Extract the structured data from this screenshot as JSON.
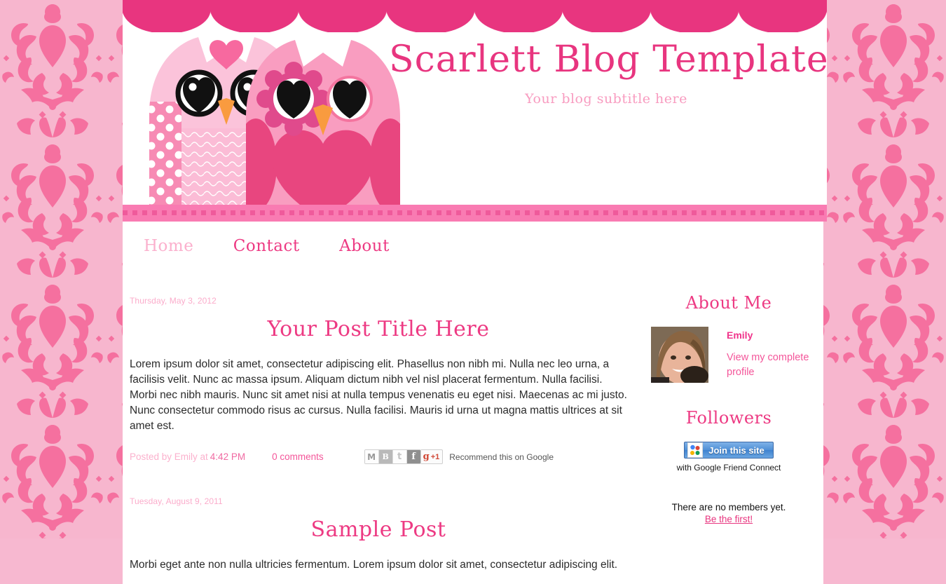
{
  "header": {
    "title": "Scarlett Blog Template",
    "subtitle": "Your blog subtitle here",
    "scallop_color": "#e8357f",
    "title_color": "#e8357f",
    "subtitle_color": "#f89cc0"
  },
  "nav": {
    "items": [
      {
        "label": "Home",
        "active": true
      },
      {
        "label": "Contact",
        "active": false
      },
      {
        "label": "About",
        "active": false
      }
    ]
  },
  "posts": [
    {
      "date": "Thursday, May 3, 2012",
      "title": "Your Post Title Here",
      "body": "Lorem ipsum dolor sit amet, consectetur adipiscing elit. Phasellus non nibh mi. Nulla nec leo urna, a facilisis velit. Nunc ac massa ipsum. Aliquam dictum nibh vel nisl placerat fermentum. Nulla facilisi. Morbi nec nibh mauris. Nunc sit amet nisi at nulla tempus venenatis eu eget nisi. Maecenas ac mi justo. Nunc consectetur commodo risus ac cursus. Nulla facilisi. Mauris id urna ut magna mattis ultrices at sit amet est.",
      "posted_by": "Posted by Emily at",
      "time": "4:42 PM",
      "comments": "0 comments",
      "share": {
        "icons": [
          "gmail-icon",
          "blogger-icon",
          "twitter-icon",
          "facebook-icon"
        ],
        "gmail_glyph": "M",
        "blogger_glyph": "B",
        "twitter_glyph": "t",
        "facebook_glyph": "f",
        "gplus_glyph": "g",
        "gplus_count": "+1",
        "recommend_text": "Recommend this on Google"
      }
    },
    {
      "date": "Tuesday, August 9, 2011",
      "title": "Sample Post",
      "body": "Morbi eget ante non nulla ultricies fermentum. Lorem ipsum dolor sit amet, consectetur adipiscing elit."
    }
  ],
  "sidebar": {
    "about": {
      "heading": "About Me",
      "name": "Emily",
      "profile_link": "View my complete profile"
    },
    "followers": {
      "heading": "Followers",
      "join_label": "Join this site",
      "gfc_sub": "with Google Friend Connect",
      "no_members": "There are no members yet.",
      "be_first": "Be the first!"
    }
  },
  "colors": {
    "hot_pink": "#e8357f",
    "mid_pink": "#f4569a",
    "light_pink": "#fbb0cd",
    "bar_pink": "#f97bb2",
    "damask_bg": "#f7b6ce",
    "damask_motif": "#f5709f"
  }
}
